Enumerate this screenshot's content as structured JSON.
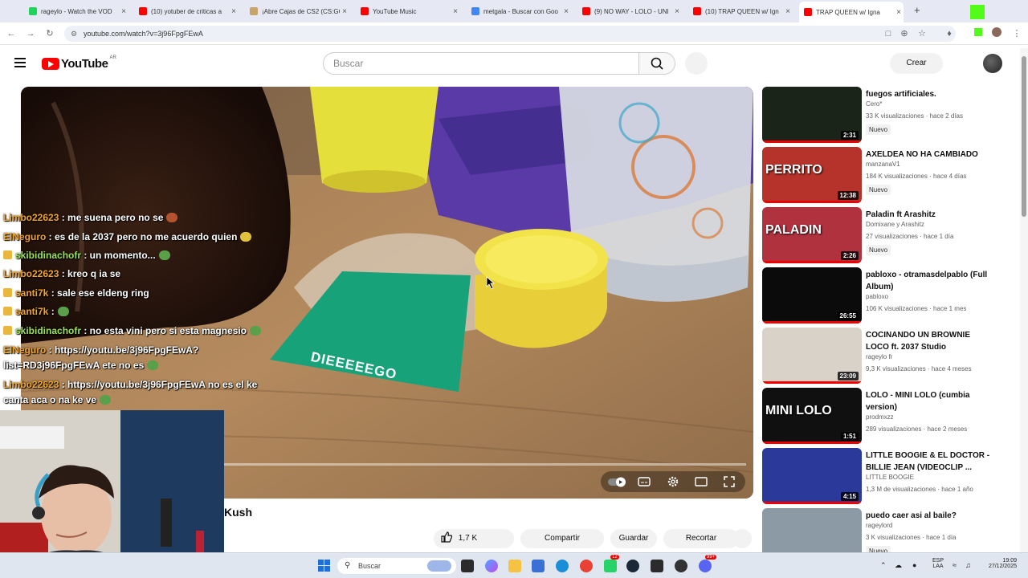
{
  "browser": {
    "tabs": [
      {
        "title": "rageylo - Watch the VOD",
        "favicon_color": "#1fd35b"
      },
      {
        "title": "(10) yotuber de criticas a",
        "favicon_color": "#ff0000"
      },
      {
        "title": "¡Abre Cajas de CS2 (CS:GO",
        "favicon_color": "#caa36a"
      },
      {
        "title": "YouTube Music",
        "favicon_color": "#ff0000"
      },
      {
        "title": "metgala - Buscar con Goo",
        "favicon_color": "#4285f4"
      },
      {
        "title": "(9) NO WAY - LOLO - UNI",
        "favicon_color": "#ff0000"
      },
      {
        "title": "(10) TRAP QUEEN w/ Ign",
        "favicon_color": "#ff0000"
      },
      {
        "title": "TRAP QUEEN w/ Igna",
        "favicon_color": "#ff0000",
        "active": true
      }
    ],
    "new_tab": "+",
    "url": "youtube.com/watch?v=3j96FpgFEwA"
  },
  "header": {
    "logo_text": "YouTube",
    "region": "AR",
    "search_placeholder": "Buscar",
    "create_label": "Crear"
  },
  "chat": [
    {
      "user": "Limbo22623",
      "user_color": "orange",
      "badge": false,
      "message": " : me suena pero no se"
    },
    {
      "user": "ElNeguro",
      "user_color": "orange",
      "badge": false,
      "message": " : es de la 2037 pero no me acuerdo quien"
    },
    {
      "user": "skibidinachofr",
      "user_color": "green",
      "badge": true,
      "message": " : un momento..."
    },
    {
      "user": "Limbo22623",
      "user_color": "orange",
      "badge": false,
      "message": " : kreo q ia se"
    },
    {
      "user": "santi7k",
      "user_color": "orange",
      "badge": true,
      "message": " : sale ese eldeng ring"
    },
    {
      "user": "santi7k",
      "user_color": "orange",
      "badge": true,
      "message": " :"
    },
    {
      "user": "skibidinachofr",
      "user_color": "green",
      "badge": true,
      "message": " : no esta vini pero si esta magnesio"
    },
    {
      "user": "ElNeguro",
      "user_color": "orange",
      "badge": false,
      "message": " : https://youtu.be/3j96FpgFEwA?"
    },
    {
      "user": "",
      "user_color": "orange",
      "badge": false,
      "message": "list=RD3j96FpgFEwA ete no es"
    },
    {
      "user": "Limbo22623",
      "user_color": "orange",
      "badge": false,
      "message": " : https://youtu.be/3j96FpgFEwA no es el ke"
    },
    {
      "user": "",
      "user_color": "orange",
      "badge": false,
      "message": "canta aca o na ke ve"
    }
  ],
  "video": {
    "title_fragment": "Kush",
    "card_text": "DIEEEEEGO",
    "likes": "1,7 K",
    "actions": {
      "share": "Compartir",
      "save": "Guardar",
      "clip": "Recortar"
    }
  },
  "recommendations": [
    {
      "title": "fuegos artificiales.",
      "channel": "Cero*",
      "meta": "33 K visualizaciones · hace 2 días",
      "duration": "2:31",
      "nuevo": "Nuevo",
      "thumb_color": "#1a2418"
    },
    {
      "title": "AXELDEA NO HA CAMBIADO",
      "channel": "manzanaV1",
      "meta": "184 K visualizaciones · hace 4 días",
      "duration": "12:38",
      "nuevo": "Nuevo",
      "thumb_color": "#b5332a",
      "thumb_text": "PERRITO"
    },
    {
      "title": "Paladin ft Arashitz",
      "channel": "Domixane    y Arashitz",
      "meta": "27 visualizaciones · hace 1 día",
      "duration": "2:26",
      "nuevo": "Nuevo",
      "thumb_color": "#b0323f",
      "thumb_text": "PALADIN"
    },
    {
      "title": "pabloxo - otramasdelpablo (Full Album)",
      "channel": "pabloxo",
      "meta": "106 K visualizaciones · hace 1 mes",
      "duration": "26:55",
      "nuevo": "",
      "thumb_color": "#0b0b0b"
    },
    {
      "title": "COCINANDO UN BROWNIE LOCO ft. 2037 Studio",
      "channel": "rageylo fr",
      "meta": "9,3 K visualizaciones · hace 4 meses",
      "duration": "23:09",
      "nuevo": "",
      "thumb_color": "#d9d2c8"
    },
    {
      "title": "LOLO - MINI LOLO (cumbia version)",
      "channel": "prodmxzz",
      "meta": "289 visualizaciones · hace 2 meses",
      "duration": "1:51",
      "nuevo": "",
      "thumb_color": "#101010",
      "thumb_text": "MINI LOLO"
    },
    {
      "title": "LITTLE BOOGIE & EL DOCTOR - BILLIE JEAN (VIDEOCLIP ...",
      "channel": "LITTLE BOOGIE",
      "meta": "1,3 M de visualizaciones · hace 1 año",
      "duration": "4:15",
      "nuevo": "",
      "thumb_color": "#2b3a9a"
    },
    {
      "title": "puedo caer asi al baile?",
      "channel": "rageylord",
      "meta": "3 K visualizaciones · hace 1 día",
      "duration": "",
      "nuevo": "Nuevo",
      "thumb_color": "#8c9aa6"
    }
  ],
  "taskbar": {
    "search_placeholder": "Buscar",
    "lang_top": "ESP",
    "lang_bottom": "LAA",
    "time": "19:09",
    "date": "27/12/2025",
    "badge_discord": "99+",
    "badge_whatsapp": "12"
  }
}
